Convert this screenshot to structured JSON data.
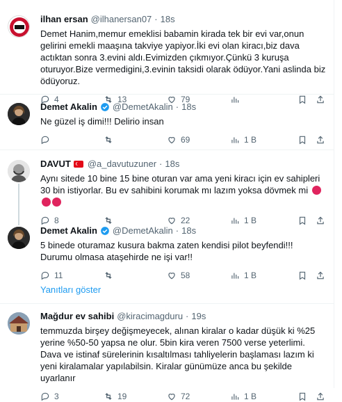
{
  "tweets": [
    {
      "name": "ilhan ersan",
      "handle": "@ilhanersan07",
      "time": "18s",
      "text": "Demet Hanim,memur emeklisi babamin kirada tek bir evi var,onun gelirini emekli maaşına takviye yapiyor.İki evi olan kiracı,biz dava actıktan sonra 3.evini aldı.Evimizden çıkmıyor.Çünkü 3 kuruşa oturuyor.Bize vermedigini,3.evinin taksidi olarak ödüyor.Yani aslinda biz ödüyoruz.",
      "replies": "4",
      "retweets": "13",
      "likes": "79",
      "views": ""
    },
    {
      "name": "Demet Akalin",
      "handle": "@DemetAkalin",
      "time": "18s",
      "text": "Ne güzel iş dimi!!! Delirio insan",
      "replies": "",
      "retweets": "",
      "likes": "69",
      "views": "1 B"
    },
    {
      "name": "DAVUT",
      "handle": "@a_davutuzuner",
      "time": "18s",
      "text": "Aynı sitede 10 bine 15 bine oturan var ama yeni kiracı için ev sahipleri 30 bin istiyorlar. Bu ev sahibini korumak mı lazım yoksa dövmek mi",
      "replies": "8",
      "retweets": "",
      "likes": "22",
      "views": "1 B"
    },
    {
      "name": "Demet Akalin",
      "handle": "@DemetAkalin",
      "time": "18s",
      "text": "5 binede oturamaz kusura bakma zaten kendisi pilot beyfendi!!! Durumu olmasa ataşehirde ne işi var!!",
      "replies": "11",
      "retweets": "",
      "likes": "58",
      "views": "1 B"
    },
    {
      "name": "Mağdur ev sahibi",
      "handle": "@kiracimagduru",
      "time": "19s",
      "text": "temmuzda birşey değişmeyecek, alınan kiralar o kadar düşük ki %25 yerine %50-50 yapsa ne olur. 5bin kira veren 7500 verse yeterlimi. Dava ve istinaf sürelerinin kısaltılması tahliyelerin başlaması lazım ki yeni kiralamalar yapılabilsin. Kiralar günümüze anca bu şekilde uyarlanır",
      "replies": "3",
      "retweets": "19",
      "likes": "72",
      "views": "1 B"
    }
  ],
  "show_replies": "Yanıtları göster",
  "colors": {
    "accent": "#1d9bf0",
    "muted": "#536471",
    "text": "#0f1419"
  },
  "icons": [
    "reply-icon",
    "retweet-icon",
    "like-icon",
    "views-icon",
    "bookmark-icon",
    "share-icon",
    "verified-icon",
    "more-icon"
  ]
}
